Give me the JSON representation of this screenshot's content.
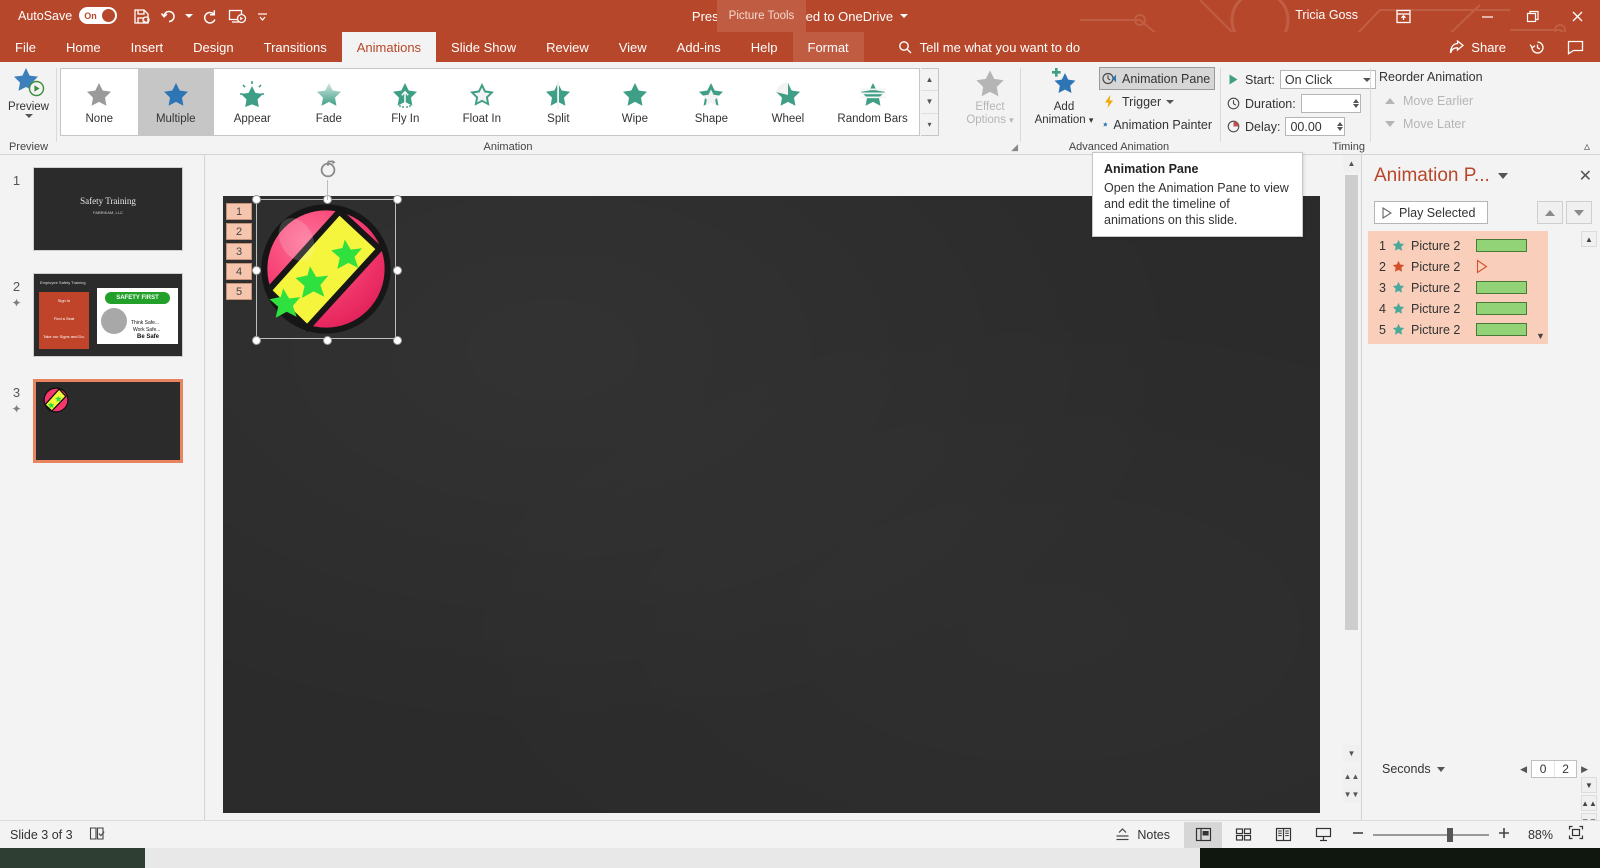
{
  "titlebar": {
    "autosave_label": "AutoSave",
    "toggle_state": "On",
    "document_title": "Presentation",
    "save_state": "Saved to OneDrive",
    "separator": "-",
    "context_tab_group": "Picture Tools",
    "user_name": "Tricia Goss",
    "qat": [
      {
        "name": "save-icon",
        "label": "Save"
      },
      {
        "name": "undo-icon",
        "label": "Undo"
      },
      {
        "name": "redo-icon",
        "label": "Redo"
      },
      {
        "name": "start-from-beginning-icon",
        "label": "Start From Beginning"
      },
      {
        "name": "customize-qat-icon",
        "label": "Customize Quick Access Toolbar"
      }
    ],
    "window_buttons": [
      {
        "name": "minimize-button",
        "glyph": "—"
      },
      {
        "name": "restore-button",
        "glyph": "❐"
      },
      {
        "name": "close-button",
        "glyph": "✕"
      }
    ]
  },
  "tabs": [
    {
      "label": "File",
      "active": false
    },
    {
      "label": "Home",
      "active": false
    },
    {
      "label": "Insert",
      "active": false
    },
    {
      "label": "Design",
      "active": false
    },
    {
      "label": "Transitions",
      "active": false
    },
    {
      "label": "Animations",
      "active": true
    },
    {
      "label": "Slide Show",
      "active": false
    },
    {
      "label": "Review",
      "active": false
    },
    {
      "label": "View",
      "active": false
    },
    {
      "label": "Add-ins",
      "active": false
    },
    {
      "label": "Help",
      "active": false
    },
    {
      "label": "Format",
      "active": false,
      "contextual": true
    }
  ],
  "tellme": {
    "placeholder": "Tell me what you want to do"
  },
  "share": {
    "label": "Share"
  },
  "ribbon": {
    "preview": {
      "group_label": "Preview",
      "button_label": "Preview"
    },
    "animation": {
      "group_label": "Animation",
      "gallery": [
        {
          "label": "None",
          "selected": false
        },
        {
          "label": "Multiple",
          "selected": true
        },
        {
          "label": "Appear",
          "selected": false
        },
        {
          "label": "Fade",
          "selected": false
        },
        {
          "label": "Fly In",
          "selected": false
        },
        {
          "label": "Float In",
          "selected": false
        },
        {
          "label": "Split",
          "selected": false
        },
        {
          "label": "Wipe",
          "selected": false
        },
        {
          "label": "Shape",
          "selected": false
        },
        {
          "label": "Wheel",
          "selected": false
        },
        {
          "label": "Random Bars",
          "selected": false
        }
      ]
    },
    "effect_options": {
      "line1": "Effect",
      "line2": "Options",
      "disabled": true
    },
    "advanced_animation": {
      "group_label": "Advanced Animation",
      "add_animation_line1": "Add",
      "add_animation_line2": "Animation",
      "items": [
        {
          "label": "Animation Pane",
          "active": true
        },
        {
          "label": "Trigger",
          "active": false
        },
        {
          "label": "Animation Painter",
          "active": false
        }
      ]
    },
    "timing": {
      "group_label": "Timing",
      "start_label": "Start:",
      "start_value": "On Click",
      "duration_label": "Duration:",
      "duration_value": "",
      "delay_label": "Delay:",
      "delay_value": "00.00"
    },
    "reorder": {
      "group_label": "Reorder Animation",
      "move_earlier": "Move Earlier",
      "move_later": "Move Later"
    }
  },
  "tooltip": {
    "title": "Animation Pane",
    "body": "Open the Animation Pane to view and edit the timeline of animations on this slide."
  },
  "thumbnails": [
    {
      "number": "1",
      "has_animation_star": false,
      "selected": false,
      "title": "Safety Training",
      "subtitle": "FABRIKAM, LLC"
    },
    {
      "number": "2",
      "has_animation_star": true,
      "selected": false,
      "heading": "Employee Safety Training",
      "blocks": [
        "Sign In",
        "Find a Seat",
        "Take our Signs and Do."
      ],
      "image_caption": "SAFETY FIRST",
      "image_lines": [
        "Think Safe...",
        "Work Safe...",
        "Be Safe"
      ]
    },
    {
      "number": "3",
      "has_animation_star": true,
      "selected": true
    }
  ],
  "slide": {
    "animation_markers": [
      "1",
      "2",
      "3",
      "4",
      "5"
    ],
    "selected_object": "beach-ball-picture"
  },
  "animation_pane": {
    "title": "Animation P...",
    "play_button": "Play Selected",
    "items": [
      {
        "index": "1",
        "name": "Picture 2",
        "star_color": "#4aa99a",
        "bar_type": "green"
      },
      {
        "index": "2",
        "name": "Picture 2",
        "star_color": "#d4502a",
        "bar_type": "triangle"
      },
      {
        "index": "3",
        "name": "Picture 2",
        "star_color": "#4aa99a",
        "bar_type": "green"
      },
      {
        "index": "4",
        "name": "Picture 2",
        "star_color": "#4aa99a",
        "bar_type": "green"
      },
      {
        "index": "5",
        "name": "Picture 2",
        "star_color": "#4aa99a",
        "bar_type": "green"
      }
    ],
    "seconds_label": "Seconds",
    "seconds_ticks": [
      "0",
      "2"
    ]
  },
  "statusbar": {
    "slide_indicator": "Slide 3 of 3",
    "notes_label": "Notes",
    "zoom_percent": "88%",
    "views": [
      {
        "name": "normal-view-button",
        "active": true
      },
      {
        "name": "slide-sorter-view-button",
        "active": false
      },
      {
        "name": "reading-view-button",
        "active": false
      },
      {
        "name": "slide-show-button",
        "active": false
      }
    ]
  },
  "colors": {
    "accent": "#b7472a",
    "ribbon_bg": "#f3f3f3",
    "slide_bg": "#2b2b2b",
    "anim_list_bg": "#f9cfbb",
    "anim_bar_green": "#91d376",
    "selection_orange": "#e8835f"
  }
}
